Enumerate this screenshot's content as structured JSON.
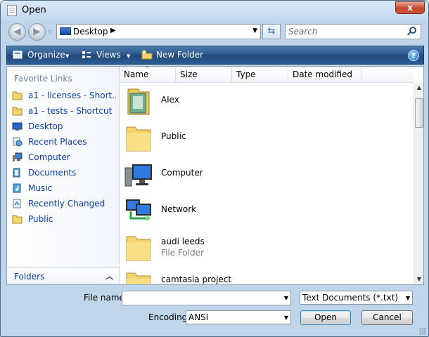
{
  "window": {
    "title": "Open",
    "close_label": "x"
  },
  "nav": {
    "back_glyph": "◀",
    "forward_glyph": "▶",
    "address": "Desktop",
    "address_sep": "▶",
    "search_placeholder": "Search"
  },
  "toolbar": {
    "organize": "Organize",
    "views": "Views",
    "new_folder": "New Folder",
    "help": "?"
  },
  "sidebar": {
    "favorite_links_label": "Favorite Links",
    "items": [
      {
        "label": "a1 - licenses - Short...",
        "icon": "folder-shortcut-icon"
      },
      {
        "label": "a1 - tests - Shortcut",
        "icon": "folder-shortcut-icon"
      },
      {
        "label": "Desktop",
        "icon": "desktop-icon"
      },
      {
        "label": "Recent Places",
        "icon": "recent-places-icon"
      },
      {
        "label": "Computer",
        "icon": "computer-icon"
      },
      {
        "label": "Documents",
        "icon": "documents-icon"
      },
      {
        "label": "Music",
        "icon": "music-icon"
      },
      {
        "label": "Recently Changed",
        "icon": "recently-changed-icon"
      },
      {
        "label": "Public",
        "icon": "folder-icon"
      }
    ],
    "folders_label": "Folders"
  },
  "filelist": {
    "columns": [
      "Name",
      "Size",
      "Type",
      "Date modified"
    ],
    "items": [
      {
        "name": "Alex",
        "sub": "",
        "icon": "user-folder-icon"
      },
      {
        "name": "Public",
        "sub": "",
        "icon": "folder-icon"
      },
      {
        "name": "Computer",
        "sub": "",
        "icon": "computer-icon"
      },
      {
        "name": "Network",
        "sub": "",
        "icon": "network-icon"
      },
      {
        "name": "audi leeds",
        "sub": "File Folder",
        "icon": "folder-icon"
      },
      {
        "name": "camtasia project",
        "sub": "",
        "icon": "folder-icon"
      }
    ]
  },
  "bottom": {
    "file_name_label": "File name:",
    "file_name_value": "",
    "file_type_selected": "Text Documents (*.txt)",
    "encoding_label": "Encoding:",
    "encoding_selected": "ANSI",
    "open_label": "Open",
    "cancel_label": "Cancel"
  },
  "colors": {
    "link_blue": "#0c3ea6",
    "toolbar_blue": "#28528a",
    "window_frame": "#bfd6ea",
    "close_red": "#c8452e",
    "folder_yellow": "#f3d36b"
  }
}
